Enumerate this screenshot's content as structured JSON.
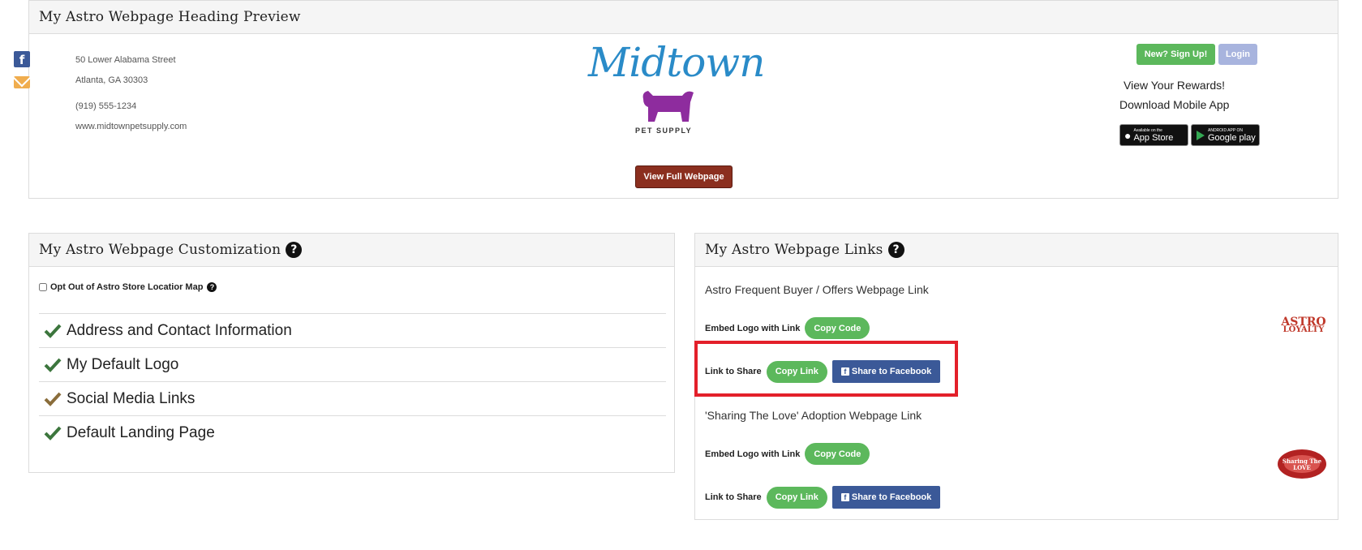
{
  "preview": {
    "title": "My Astro Webpage Heading Preview",
    "address_line1": "50 Lower Alabama Street",
    "address_line2": "Atlanta, GA 30303",
    "phone": "(919) 555-1234",
    "website": "www.midtownpetsupply.com",
    "logo_main": "Midtown",
    "logo_sub": "PET SUPPLY",
    "view_full_label": "View Full Webpage",
    "signup_label": "New? Sign Up!",
    "login_label": "Login",
    "rewards_link": "View Your Rewards!",
    "download_link": "Download Mobile App",
    "appstore_small": "Available on the",
    "appstore_big": "App Store",
    "googleplay_small": "ANDROID APP ON",
    "googleplay_big": "Google play"
  },
  "customization": {
    "title": "My Astro Webpage Customization",
    "optout_label": "Opt Out of Astro Store Locatior Map",
    "items": [
      {
        "label": "Address and Contact Information",
        "color": "#3c763d"
      },
      {
        "label": "My Default Logo",
        "color": "#3c763d"
      },
      {
        "label": "Social Media Links",
        "color": "#8a6d3b"
      },
      {
        "label": "Default Landing Page",
        "color": "#3c763d"
      }
    ]
  },
  "links": {
    "title": "My Astro Webpage Links",
    "sections": [
      {
        "title": "Astro Frequent Buyer / Offers Webpage Link",
        "embed_label": "Embed Logo with Link",
        "copy_code_label": "Copy Code",
        "share_label": "Link to Share",
        "copy_link_label": "Copy Link",
        "facebook_label": "Share to Facebook",
        "logo_line1": "ASTRO",
        "logo_line2": "LOYALTY"
      },
      {
        "title": "'Sharing The Love' Adoption Webpage Link",
        "embed_label": "Embed Logo with Link",
        "copy_code_label": "Copy Code",
        "share_label": "Link to Share",
        "copy_link_label": "Copy Link",
        "facebook_label": "Share to Facebook",
        "logo_text": "Sharing The LOVE"
      }
    ]
  },
  "colors": {
    "green": "#5cb85c",
    "facebook": "#3b5998",
    "highlight": "#e3202a",
    "view_button": "#8b2f1f"
  }
}
